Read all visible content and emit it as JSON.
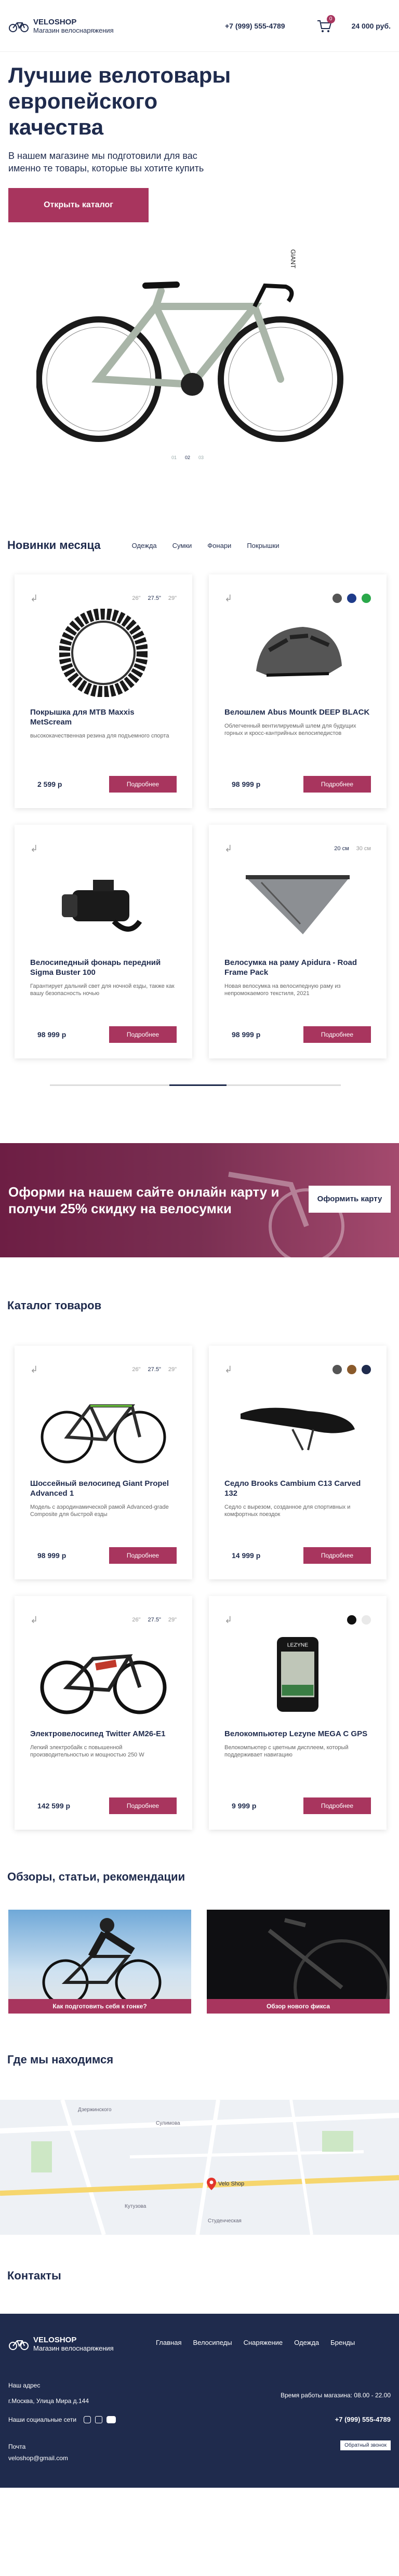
{
  "header": {
    "logo_title": "VELOSHOP",
    "logo_sub": "Магазин велоснаряжения",
    "phone": "+7 (999) 555-4789",
    "cart_count": "0",
    "cart_total": "24 000 руб."
  },
  "hero": {
    "title": "Лучшие велотовары европейского качества",
    "subtitle": "В нашем магазине мы подготовили для вас именно те товары, которые вы хотите купить",
    "cta": "Открыть каталог",
    "dots": [
      "01",
      "02",
      "03"
    ]
  },
  "new_items": {
    "title": "Новинки месяца",
    "tabs": [
      "Одежда",
      "Сумки",
      "Фонари",
      "Покрышки"
    ],
    "cards": [
      {
        "title": "Покрышка для MTB Maxxis MetScream",
        "desc": "высококачественная резина для подъемного спорта",
        "price": "2 599 р",
        "button": "Подробнее",
        "sizes": [
          "26\"",
          "27.5\"",
          "29\""
        ]
      },
      {
        "title": "Велошлем Abus Mountk DEEP BLACK",
        "desc": "Облегченный вентилируемый шлем для будущих горных и кросс-кантрийных велосипедистов",
        "price": "98 999 р",
        "button": "Подробнее",
        "colors": [
          "#555555",
          "#1e3b8a",
          "#2aa84a"
        ]
      },
      {
        "title": "Велосипедный фонарь передний Sigma Buster 100",
        "desc": "Гарантирует дальний свет для ночной езды, также как вашу безопасность ночью",
        "price": "98 999 р",
        "button": "Подробнее"
      },
      {
        "title": "Велосумка на раму Apidura - Road Frame Pack",
        "desc": "Новая велосумка на велосипедную раму из непромокаемого текстиля, 2021",
        "price": "98 999 р",
        "button": "Подробнее",
        "sizes": [
          "20 см",
          "30 см"
        ]
      }
    ]
  },
  "promo": {
    "text": "Оформи на нашем сайте онлайн карту и получи 25% скидку на велосумки",
    "button": "Оформить карту"
  },
  "catalog": {
    "title": "Каталог товаров",
    "cards": [
      {
        "title": "Шоссейный велосипед Giant Propel Advanced 1",
        "desc": "Модель с аэродинамической рамой Advanced-grade Composite для быстрой езды",
        "price": "98 999 р",
        "button": "Подробнее",
        "sizes": [
          "26\"",
          "27.5\"",
          "29\""
        ]
      },
      {
        "title": "Седло Brooks Cambium C13 Carved 132",
        "desc": "Седло с вырезом, созданное для спортивных и комфортных поездок",
        "price": "14 999 р",
        "button": "Подробнее",
        "colors": [
          "#555555",
          "#8a5a2b",
          "#1f2b4d"
        ]
      },
      {
        "title": "Электровелосипед Twitter AM26-E1",
        "desc": "Легкий электробайк с повышенной производительностью и мощностью 250 W",
        "price": "142 599 р",
        "button": "Подробнее",
        "sizes": [
          "26\"",
          "27.5\"",
          "29\""
        ]
      },
      {
        "title": "Велокомпьютер Lezyne MEGA C GPS",
        "desc": "Велокомпьютер с цветным дисплеем, который поддерживает навигацию",
        "price": "9 999 р",
        "button": "Подробнее",
        "colors": [
          "#111111",
          "#e9e9e9"
        ]
      }
    ]
  },
  "reviews": {
    "title": "Обзоры, статьи, рекомендации",
    "items": [
      {
        "caption": "Как подготовить себя к гонке?"
      },
      {
        "caption": "Обзор нового фикса"
      }
    ]
  },
  "map": {
    "title": "Где мы находимся",
    "marker": "Velo Shop",
    "streets": [
      "Дзержинского",
      "Сулимова",
      "Кутузова",
      "Студенческая"
    ]
  },
  "contacts": {
    "title": "Контакты"
  },
  "footer": {
    "logo_title": "VELOSHOP",
    "logo_sub": "Магазин велоснаряжения",
    "nav": [
      "Главная",
      "Велосипеды",
      "Снаряжение",
      "Одежда",
      "Бренды"
    ],
    "address_label": "Наш адрес",
    "address": "г.Москва, Улица Мира д.144",
    "hours": "Время работы магазина: 08.00 - 22.00",
    "social_label": "Наши социальные сети",
    "phone": "+7 (999) 555-4789",
    "mail_label": "Почта",
    "mail": "veloshop@gmail.com",
    "callback": "Обратный звонок"
  },
  "colors": {
    "accent": "#a8355e",
    "text": "#1f2b4d"
  }
}
